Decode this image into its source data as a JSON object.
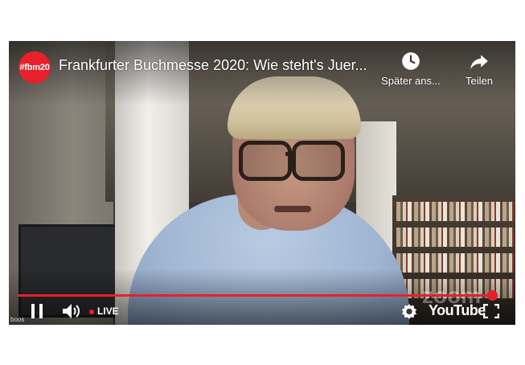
{
  "channel": {
    "avatar_text": "#fbm20",
    "brand_color": "#e8202a"
  },
  "video": {
    "title": "Frankfurter Buchmesse 2020: Wie steht's Juer...",
    "participant_name": "boos",
    "watermark": "zoom"
  },
  "actions": {
    "watch_later_label": "Später ans...",
    "watch_later_icon": "clock-icon",
    "share_label": "Teilen",
    "share_icon": "share-arrow-icon"
  },
  "controls": {
    "play_state_icon": "pause-icon",
    "volume_icon": "volume-icon",
    "live_label": "LIVE",
    "live_color": "#e6212b",
    "settings_icon": "gear-icon",
    "logo_text": "YouTube",
    "fullscreen_icon": "fullscreen-icon",
    "progress_fraction": 0.97
  }
}
